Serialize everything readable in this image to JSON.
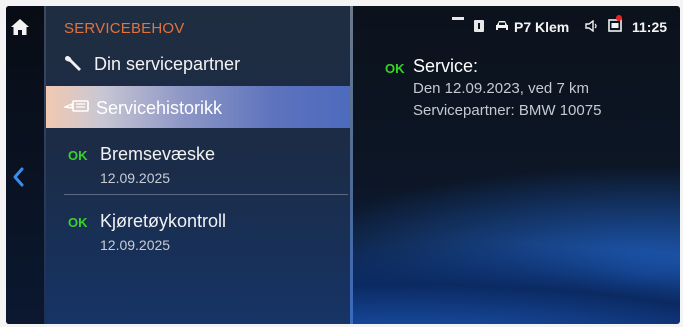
{
  "header": {
    "section_title": "SERVICEBEHOV"
  },
  "menu": {
    "items": [
      {
        "label": "Din servicepartner",
        "icon": "wrench-icon"
      },
      {
        "label": "Servicehistorikk",
        "icon": "service-book-icon",
        "selected": true
      },
      {
        "label": "Bremsevæske",
        "status": "OK",
        "date": "12.09.2025"
      },
      {
        "label": "Kjøretøykontroll",
        "status": "OK",
        "date": "12.09.2025"
      }
    ]
  },
  "status_bar": {
    "terminal": "P7 Klem",
    "time": "11:25"
  },
  "detail": {
    "status": "OK",
    "title": "Service:",
    "line1": "Den 12.09.2023, ved 7 km",
    "line2": "Servicepartner: BMW 10075"
  },
  "colors": {
    "accent_orange": "#e2733d",
    "ok_green": "#39d22a",
    "selection_blue": "#5d73bd",
    "notification_red": "#e22222"
  }
}
